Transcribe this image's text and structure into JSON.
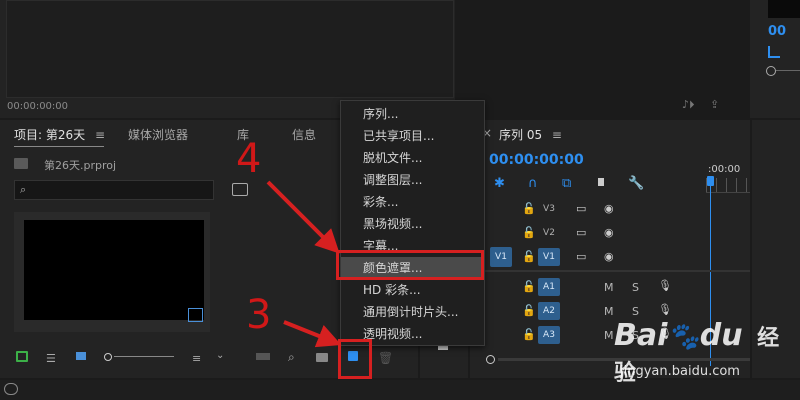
{
  "source_monitor": {
    "timecode": "00:00:00:00"
  },
  "project_panel": {
    "tabs": [
      "项目: 第26天",
      "媒体浏览器",
      "库",
      "信息"
    ],
    "project_file": "第26天.prproj"
  },
  "sequence": {
    "tab_label": "序列 05",
    "timecode": "00:00:00:00",
    "ruler_label": ":00:00"
  },
  "tracks": {
    "video": [
      {
        "target": "",
        "label": "V3"
      },
      {
        "target": "",
        "label": "V2"
      },
      {
        "target": "V1",
        "label": "V1"
      }
    ],
    "audio": [
      {
        "label": "A1",
        "m": "M",
        "s": "S"
      },
      {
        "label": "A2",
        "m": "M",
        "s": "S"
      },
      {
        "label": "A3",
        "m": "M",
        "s": "S"
      }
    ]
  },
  "new_item_menu": {
    "items": [
      "序列...",
      "已共享项目...",
      "脱机文件...",
      "调整图层...",
      "彩条...",
      "黑场视频...",
      "字幕...",
      "颜色遮罩...",
      "HD 彩条...",
      "通用倒计时片头...",
      "透明视频..."
    ],
    "highlighted": "颜色遮罩..."
  },
  "annotations": {
    "step_top": "4",
    "step_bottom": "3",
    "color": "#d62020"
  },
  "watermark": {
    "brand": "Bai",
    "brand_suffix": "du",
    "site_label": "经验",
    "url": "jingyan.baidu.com"
  },
  "colors": {
    "accent_blue": "#2e8ff0",
    "playhead": "#2e8ff0",
    "green_lock": "#3cb048"
  }
}
